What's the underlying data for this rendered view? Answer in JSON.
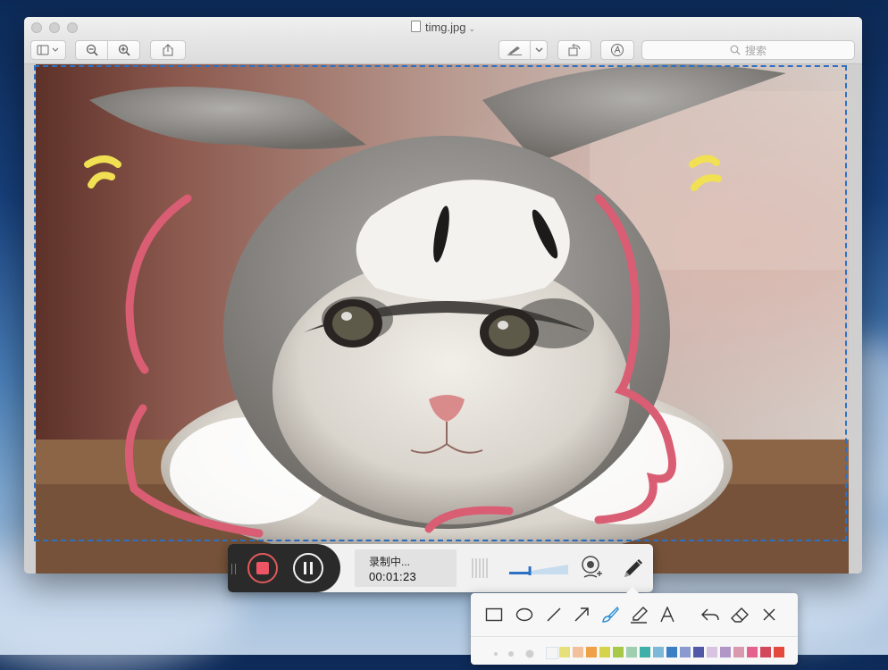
{
  "window": {
    "title": "timg.jpg",
    "search_placeholder": "搜索"
  },
  "toolbar": {
    "buttons": [
      "sidebar-toggle",
      "zoom-out",
      "zoom-in",
      "share",
      "markup",
      "rotate",
      "annotate"
    ]
  },
  "recorder": {
    "status_text": "录制中...",
    "elapsed_time": "00:01:23",
    "volume_level": 0.35,
    "colors": {
      "stop": "#ed5565",
      "accent": "#2c71c4"
    }
  },
  "annotation_panel": {
    "tools": [
      "rectangle",
      "ellipse",
      "line",
      "arrow",
      "brush",
      "highlighter",
      "text",
      "undo",
      "eraser",
      "close"
    ],
    "active_tool": "brush",
    "palette": [
      "#f5f5f5",
      "#e7e07a",
      "#f2c09a",
      "#f0a049",
      "#d5d34a",
      "#a8c84a",
      "#9fcfae",
      "#3fb0a7",
      "#7db8d8",
      "#3d7fc4",
      "#8a9ad0",
      "#5158a8",
      "#d8c4e0",
      "#b197c7",
      "#d99ab0",
      "#e3638c",
      "#d4485c",
      "#e34a3d"
    ]
  }
}
